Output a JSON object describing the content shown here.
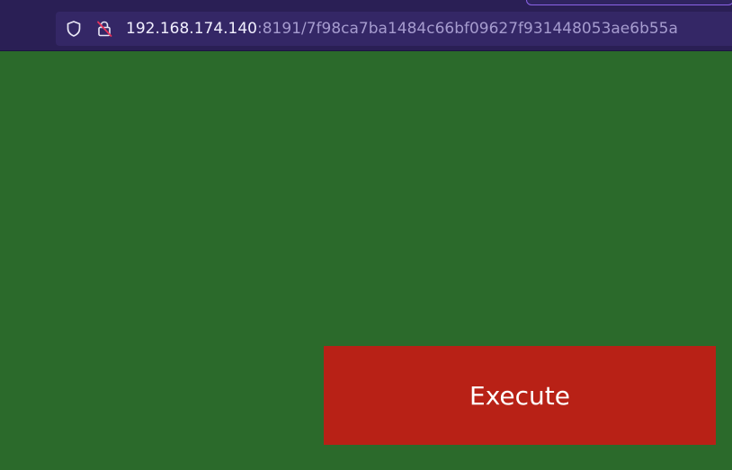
{
  "browser": {
    "url_host": "192.168.174.140",
    "url_rest": ":8191/7f98ca7ba1484c66bf09627f931448053ae6b55a",
    "icons": [
      "shield-icon",
      "lock-insecure-icon"
    ]
  },
  "main": {
    "execute_label": "Execute"
  },
  "colors": {
    "page_background": "#2b6a2b",
    "button_background": "#b82116",
    "toolbar_background": "#2a1f55"
  }
}
